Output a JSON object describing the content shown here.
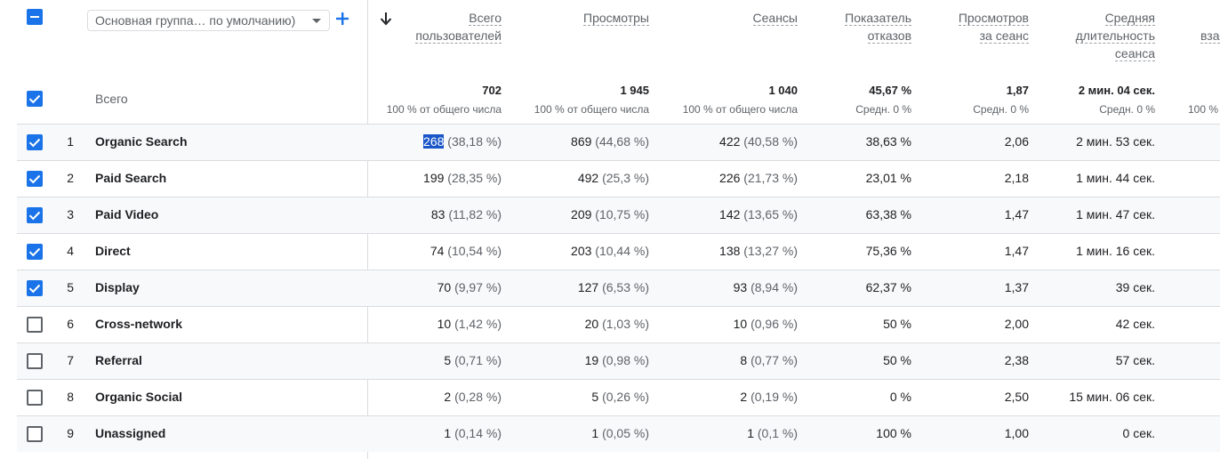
{
  "toolbar": {
    "group_select": "Основная группа… по умолчанию)",
    "add_icon": "plus-icon",
    "sort_icon": "arrow-down-icon"
  },
  "columns": [
    {
      "label_lines": [
        "Всего",
        "пользователей"
      ],
      "total": "702",
      "total_sub": "100 % от общего числа"
    },
    {
      "label_lines": [
        "Просмотры"
      ],
      "total": "1 945",
      "total_sub": "100 % от общего числа"
    },
    {
      "label_lines": [
        "Сеансы"
      ],
      "total": "1 040",
      "total_sub": "100 % от общего числа"
    },
    {
      "label_lines": [
        "Показатель",
        "отказов"
      ],
      "total": "45,67 %",
      "total_sub": "Средн. 0 %"
    },
    {
      "label_lines": [
        "Просмотров",
        "за сеанс"
      ],
      "total": "1,87",
      "total_sub": "Средн. 0 %"
    },
    {
      "label_lines": [
        "Средняя",
        "длительность",
        "сеанса"
      ],
      "total": "2 мин. 04 сек.",
      "total_sub": "Средн. 0 %"
    },
    {
      "label_lines": [
        "вза"
      ],
      "total": "",
      "total_sub": "100 %"
    }
  ],
  "totals_label": "Всего",
  "rows": [
    {
      "n": "1",
      "name": "Organic Search",
      "checked": true,
      "users": "268",
      "users_pct": "(38,18 %)",
      "views": "869",
      "views_pct": "(44,68 %)",
      "sessions": "422",
      "sessions_pct": "(40,58 %)",
      "bounce": "38,63 %",
      "vps": "2,06",
      "dur": "2 мин. 53 сек."
    },
    {
      "n": "2",
      "name": "Paid Search",
      "checked": true,
      "users": "199",
      "users_pct": "(28,35 %)",
      "views": "492",
      "views_pct": "(25,3 %)",
      "sessions": "226",
      "sessions_pct": "(21,73 %)",
      "bounce": "23,01 %",
      "vps": "2,18",
      "dur": "1 мин. 44 сек."
    },
    {
      "n": "3",
      "name": "Paid Video",
      "checked": true,
      "users": "83",
      "users_pct": "(11,82 %)",
      "views": "209",
      "views_pct": "(10,75 %)",
      "sessions": "142",
      "sessions_pct": "(13,65 %)",
      "bounce": "63,38 %",
      "vps": "1,47",
      "dur": "1 мин. 47 сек."
    },
    {
      "n": "4",
      "name": "Direct",
      "checked": true,
      "users": "74",
      "users_pct": "(10,54 %)",
      "views": "203",
      "views_pct": "(10,44 %)",
      "sessions": "138",
      "sessions_pct": "(13,27 %)",
      "bounce": "75,36 %",
      "vps": "1,47",
      "dur": "1 мин. 16 сек."
    },
    {
      "n": "5",
      "name": "Display",
      "checked": true,
      "users": "70",
      "users_pct": "(9,97 %)",
      "views": "127",
      "views_pct": "(6,53 %)",
      "sessions": "93",
      "sessions_pct": "(8,94 %)",
      "bounce": "62,37 %",
      "vps": "1,37",
      "dur": "39 сек."
    },
    {
      "n": "6",
      "name": "Cross-network",
      "checked": false,
      "users": "10",
      "users_pct": "(1,42 %)",
      "views": "20",
      "views_pct": "(1,03 %)",
      "sessions": "10",
      "sessions_pct": "(0,96 %)",
      "bounce": "50 %",
      "vps": "2,00",
      "dur": "42 сек."
    },
    {
      "n": "7",
      "name": "Referral",
      "checked": false,
      "users": "5",
      "users_pct": "(0,71 %)",
      "views": "19",
      "views_pct": "(0,98 %)",
      "sessions": "8",
      "sessions_pct": "(0,77 %)",
      "bounce": "50 %",
      "vps": "2,38",
      "dur": "57 сек."
    },
    {
      "n": "8",
      "name": "Organic Social",
      "checked": false,
      "users": "2",
      "users_pct": "(0,28 %)",
      "views": "5",
      "views_pct": "(0,26 %)",
      "sessions": "2",
      "sessions_pct": "(0,19 %)",
      "bounce": "0 %",
      "vps": "2,50",
      "dur": "15 мин. 06 сек."
    },
    {
      "n": "9",
      "name": "Unassigned",
      "checked": false,
      "users": "1",
      "users_pct": "(0,14 %)",
      "views": "1",
      "views_pct": "(0,05 %)",
      "sessions": "1",
      "sessions_pct": "(0,1 %)",
      "bounce": "100 %",
      "vps": "1,00",
      "dur": "0 сек."
    }
  ],
  "colors": {
    "accent": "#1a73e8",
    "highlight": "#1a56c8",
    "border": "#dadce0",
    "alt_row": "#f8f9fa"
  }
}
